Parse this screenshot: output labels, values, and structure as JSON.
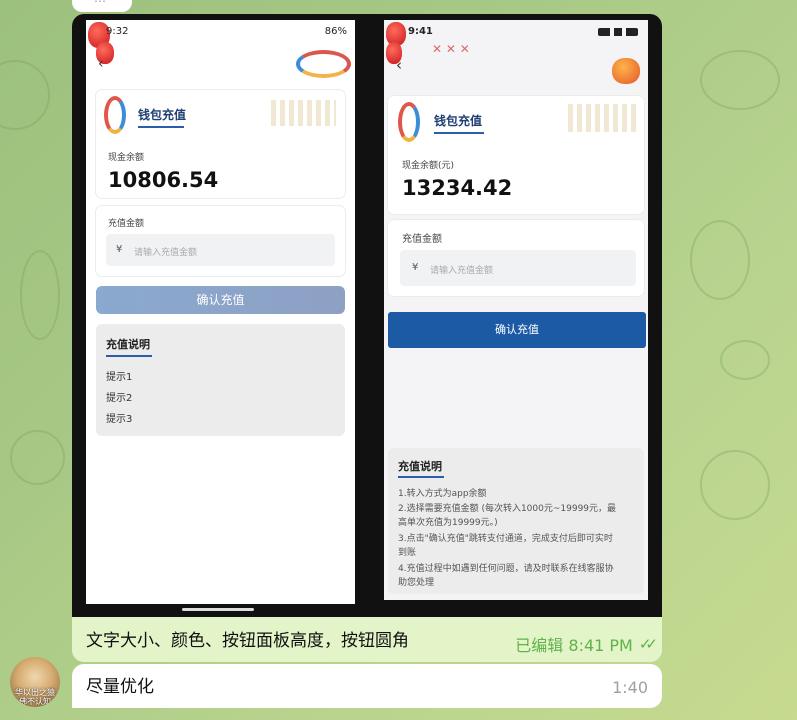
{
  "chat": {
    "top_bubble_text": "…",
    "message1": {
      "caption": "文字大小、颜色、按钮面板高度，按钮圆角",
      "meta": "已编辑 8:41 PM",
      "status_icon": "double-check-icon"
    },
    "message2": {
      "text": "尽量优化",
      "time": "1:40",
      "avatar_text": "华以出之猿\n佛不认知"
    }
  },
  "phoneA": {
    "status_time": "9:32",
    "status_right": "86%",
    "header_title": "钱包充值",
    "balance_label": "现金余额",
    "balance_value": "10806.54",
    "amount_label": "充值金额",
    "currency": "¥",
    "input_placeholder": "请输入充值金额",
    "confirm_button": "确认充值",
    "hints_title": "充值说明",
    "hints": [
      "提示1",
      "提示2",
      "提示3"
    ],
    "colors": {
      "button": "#8aa6c9",
      "title": "#1f3f73"
    }
  },
  "phoneB": {
    "status_time": "9:41",
    "header_title": "钱包充值",
    "balance_label": "现金余额(元)",
    "balance_value": "13234.42",
    "amount_label": "充值金额",
    "currency": "¥",
    "input_placeholder": "请输入充值金额",
    "confirm_button": "确认充值",
    "hints_title": "充值说明",
    "hints": [
      "1.转入方式为app余额",
      "2.选择需要充值金额 (每次转入1000元~19999元，最",
      "高单次充值为19999元。)",
      "3.点击\"确认充值\"跳转支付通道，完成支付后即可实时",
      "到账",
      "4.充值过程中如遇到任何问题，请及时联系在线客服协",
      "助您处理"
    ],
    "colors": {
      "button": "#1c5aa6",
      "title": "#1f3f73"
    }
  }
}
